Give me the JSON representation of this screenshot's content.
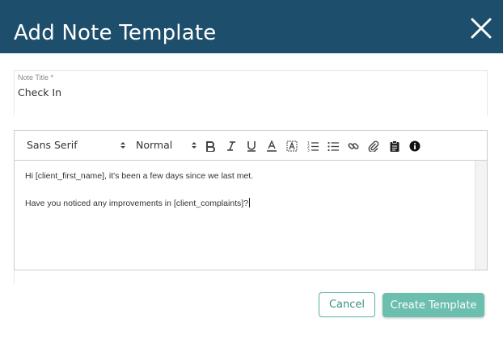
{
  "dialog": {
    "title": "Add Note Template",
    "close_icon": "close-icon",
    "header_color": "#1d4e6b"
  },
  "title_field": {
    "label": "Note Title *",
    "value": "Check In"
  },
  "toolbar": {
    "font_family": "Sans Serif",
    "font_size": "Normal",
    "icons": [
      "bold-icon",
      "italic-icon",
      "underline-icon",
      "text-color-icon",
      "background-color-icon",
      "ordered-list-icon",
      "bullet-list-icon",
      "link-icon",
      "attachment-icon",
      "clipboard-icon",
      "info-icon"
    ]
  },
  "editor": {
    "lines": [
      "Hi [client_first_name], it's been a few days since we last met.",
      "Have you noticed any improvements in [client_complaints]?"
    ]
  },
  "actions": {
    "cancel_label": "Cancel",
    "create_label": "Create Template",
    "accent": "#6cbfae"
  }
}
